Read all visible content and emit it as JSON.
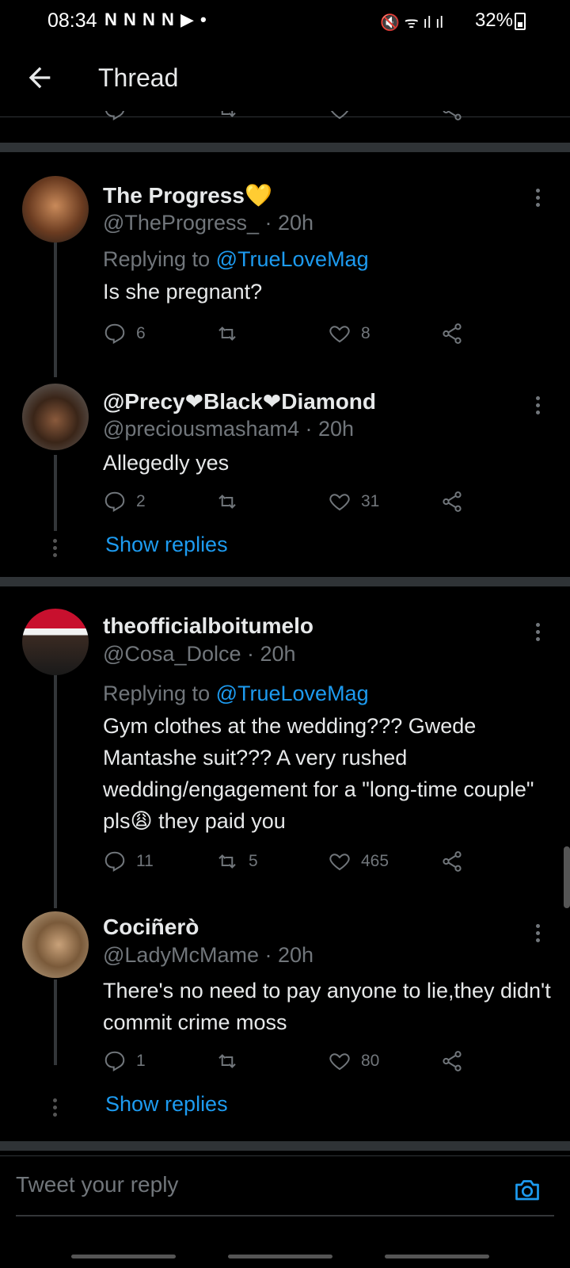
{
  "status_bar": {
    "time": "08:34",
    "notif_icons": "N N N N ▶ •",
    "battery": "32%"
  },
  "header": {
    "title": "Thread"
  },
  "tweets": [
    {
      "name": "The Progress💛",
      "handle": "@TheProgress_ · 20h",
      "replying_prefix": "Replying to ",
      "replying_to": "@TrueLoveMag",
      "text": "Is she pregnant?",
      "replies": "6",
      "retweets": "",
      "likes": "8"
    },
    {
      "name": "@Precy❤Black❤Diamond",
      "handle": "@preciousmasham4 · 20h",
      "text": "Allegedly yes",
      "replies": "2",
      "retweets": "",
      "likes": "31",
      "show_replies": "Show replies"
    },
    {
      "name": "theofficialboitumelo",
      "handle": "@Cosa_Dolce · 20h",
      "replying_prefix": "Replying to ",
      "replying_to": "@TrueLoveMag",
      "text": "Gym clothes at the wedding??? Gwede Mantashe suit??? A very rushed wedding/engagement for a \"long-time couple\" pls😩 they paid you",
      "replies": "11",
      "retweets": "5",
      "likes": "465"
    },
    {
      "name": "Cociñerò",
      "handle": "@LadyMcMame · 20h",
      "text": "There's no need to pay anyone to lie,they didn't commit crime moss",
      "replies": "1",
      "retweets": "",
      "likes": "80",
      "show_replies": "Show replies"
    }
  ],
  "compose": {
    "placeholder": "Tweet your reply"
  },
  "colors": {
    "background": "#000000",
    "link": "#1d9bf0",
    "muted": "#71767b",
    "separator": "#2f3336"
  }
}
